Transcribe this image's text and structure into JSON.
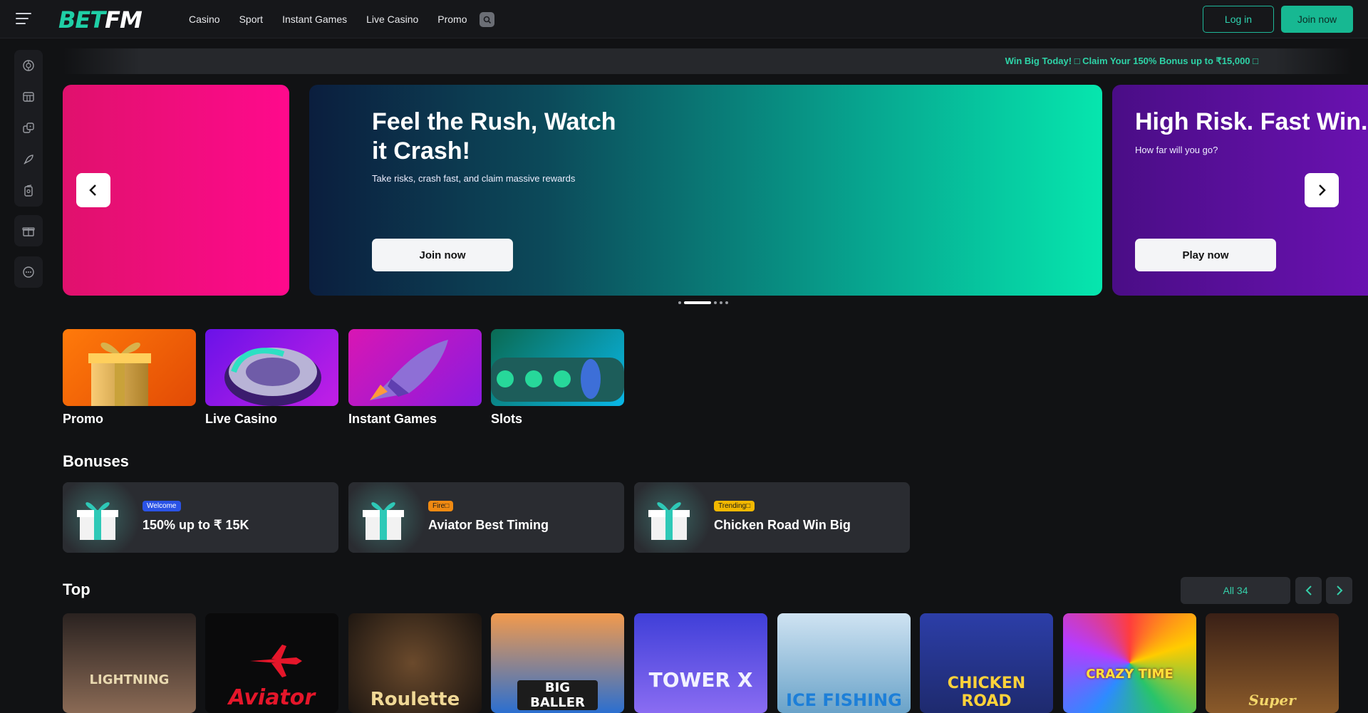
{
  "header": {
    "logo_part1": "BET",
    "logo_part2": "FM",
    "nav": [
      "Casino",
      "Sport",
      "Instant Games",
      "Live Casino",
      "Promo"
    ],
    "login": "Log in",
    "join": "Join now"
  },
  "ticker": {
    "text": "Win Big Today! □ Claim Your 150% Bonus up to ₹15,000 □"
  },
  "carousel": {
    "slides": [
      {
        "title": "",
        "subtitle": "",
        "button": ""
      },
      {
        "title": "Feel the Rush, Watch it Crash!",
        "subtitle": "Take risks, crash fast, and claim massive rewards",
        "button": "Join now"
      },
      {
        "title": "High Risk. Fast Win.",
        "subtitle": "How far will you go?",
        "button": "Play now"
      }
    ],
    "active_index": 1,
    "dot_count": 5
  },
  "categories": [
    {
      "label": "Promo",
      "icon": "gift-box"
    },
    {
      "label": "Live Casino",
      "icon": "poker-chip"
    },
    {
      "label": "Instant Games",
      "icon": "rocket"
    },
    {
      "label": "Slots",
      "icon": "clover-reels"
    }
  ],
  "bonuses": {
    "title": "Bonuses",
    "items": [
      {
        "badge": "Welcome",
        "badge_color": "#2b53e6",
        "badge_text_color": "#ffffff",
        "title": "150% up to ₹ 15K"
      },
      {
        "badge": "Fire□",
        "badge_color": "#f08a12",
        "badge_text_color": "#1a1a1a",
        "title": "Aviator Best Timing"
      },
      {
        "badge": "Trending□",
        "badge_color": "#f2b800",
        "badge_text_color": "#1a1a1a",
        "title": "Chicken Road Win Big"
      }
    ]
  },
  "top": {
    "title": "Top",
    "all_label": "All 34",
    "games": [
      {
        "name": "LIGHTNING"
      },
      {
        "name": "Aviator"
      },
      {
        "name": "Roulette"
      },
      {
        "name": "BIG BALLER"
      },
      {
        "name": "TOWER X"
      },
      {
        "name": "ICE FISHING"
      },
      {
        "name": "CHICKEN ROAD"
      },
      {
        "name": "CRAZY TIME"
      },
      {
        "name": "Super"
      }
    ]
  },
  "colors": {
    "accent": "#17b892",
    "background": "#111214",
    "panel": "#2a2c31"
  }
}
